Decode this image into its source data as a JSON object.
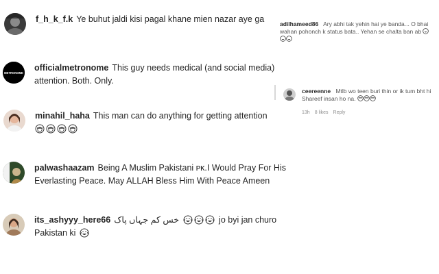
{
  "comments": [
    {
      "username": "f_h_k_f.k",
      "text": "Ye buhut jaldi kisi pagal khane mien nazar aye ga",
      "avatar_icon": "profile-photo-dark",
      "emoji_icons": []
    },
    {
      "username": "officialmetronome",
      "text": "This guy needs medical (and social media) attention. Both. Only.",
      "avatar_icon": "metronome-logo",
      "avatar_text": "METRONOME",
      "emoji_icons": []
    },
    {
      "username": "minahil_haha",
      "text": "This man can do anything for getting attention",
      "avatar_icon": "profile-photo-woman",
      "emoji_icons": [
        "monkey-face",
        "monkey-face",
        "monkey-face",
        "monkey-face"
      ]
    },
    {
      "username": "palwashaazam",
      "text": "Being A Muslim Pakistani ᴘᴋ.I Would Pray For His Everlasting Peace. May ALLAH Bless Him With Peace Ameen",
      "avatar_icon": "profile-photo-flag",
      "emoji_icons": []
    },
    {
      "username": "its_ashyyy_here66",
      "text_urdu": "خس کم جہاں پاک",
      "text_line1": "jo byi jan churo",
      "text_line2": "Pakistan ki",
      "avatar_icon": "profile-photo-girl",
      "emoji_icons": [
        "tears-of-joy",
        "tears-of-joy",
        "tears-of-joy",
        "tears-of-joy"
      ]
    }
  ],
  "side_comments": [
    {
      "username": "adilhameed86",
      "text": "Ary abhi tak yehin hai ye banda... O bhai wahan pohonch k status bata.. Yehan se chalta ban ab",
      "emoji_icons": [
        "tears-of-joy",
        "tears-of-joy",
        "tears-of-joy"
      ]
    },
    {
      "username": "ceereenne",
      "text": "Mtlb wo teen buri thin or ik tum bht hi Shareef insan ho na.",
      "emoji_icons": [
        "monkey-face",
        "monkey-face",
        "monkey-face"
      ],
      "meta": {
        "time": "13h",
        "likes": "8 likes",
        "reply": "Reply"
      }
    }
  ],
  "colors": {
    "text": "#262626",
    "muted": "#8e8e8e",
    "background": "#ffffff"
  }
}
